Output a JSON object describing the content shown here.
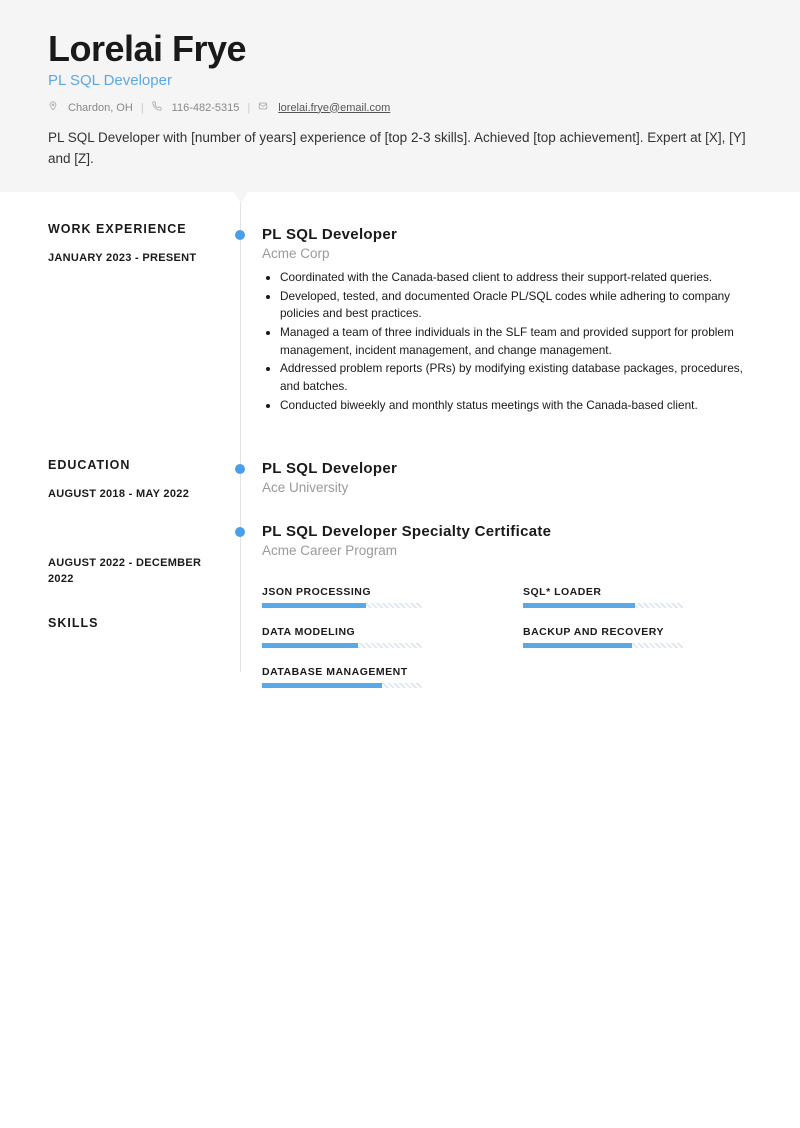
{
  "header": {
    "name": "Lorelai Frye",
    "title": "PL SQL Developer",
    "location": "Chardon, OH",
    "phone": "116-482-5315",
    "email": "lorelai.frye@email.com"
  },
  "summary": "PL SQL Developer with [number of years] experience of [top 2-3 skills]. Achieved [top achievement]. Expert at [X], [Y] and [Z].",
  "sections": {
    "work": "WORK EXPERIENCE",
    "education": "EDUCATION",
    "skills": "SKILLS"
  },
  "work": [
    {
      "date": "JANUARY 2023 - PRESENT",
      "title": "PL SQL Developer",
      "org": "Acme Corp",
      "bullets": [
        "Coordinated with the Canada-based client to address their support-related queries.",
        "Developed, tested, and documented Oracle PL/SQL codes while adhering to company policies and best practices.",
        "Managed a team of three individuals in the SLF team and provided support for problem management, incident management, and change management.",
        "Addressed problem reports (PRs) by modifying existing database packages, procedures, and batches.",
        "Conducted biweekly and monthly status meetings with the Canada-based client."
      ]
    }
  ],
  "education": [
    {
      "date": "AUGUST 2018 - MAY 2022",
      "title": "PL SQL Developer",
      "org": "Ace University"
    },
    {
      "date": "AUGUST 2022 - DECEMBER 2022",
      "title": "PL SQL Developer Specialty Certificate",
      "org": "Acme Career Program"
    }
  ],
  "skills": [
    {
      "name": "JSON PROCESSING",
      "pct": 65
    },
    {
      "name": "SQL* LOADER",
      "pct": 70
    },
    {
      "name": "DATA MODELING",
      "pct": 60
    },
    {
      "name": "BACKUP AND RECOVERY",
      "pct": 68
    },
    {
      "name": "DATABASE MANAGEMENT",
      "pct": 75
    }
  ]
}
